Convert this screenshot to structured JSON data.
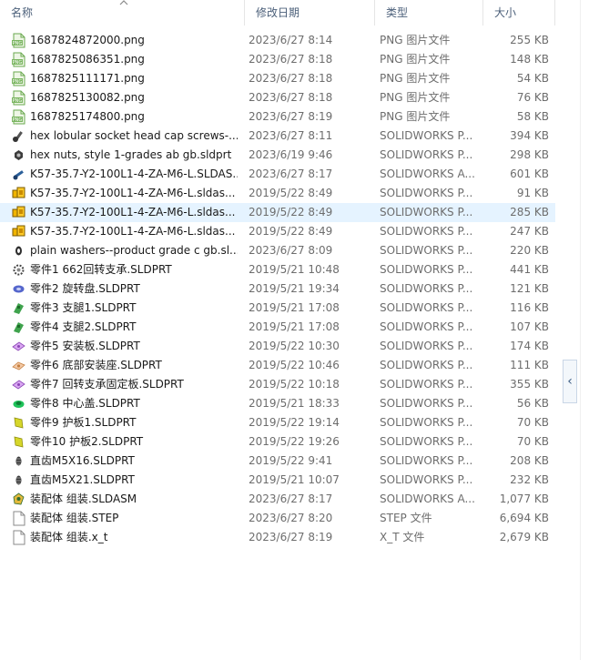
{
  "columns": {
    "name": "名称",
    "date": "修改日期",
    "type": "类型",
    "size": "大小"
  },
  "side_button_glyph": "‹",
  "files": [
    {
      "icon": "png-image-icon",
      "name": "1687824872000.png",
      "date": "2023/6/27 8:14",
      "type": "PNG 图片文件",
      "size": "255 KB"
    },
    {
      "icon": "png-image-icon",
      "name": "1687825086351.png",
      "date": "2023/6/27 8:18",
      "type": "PNG 图片文件",
      "size": "148 KB"
    },
    {
      "icon": "png-image-icon",
      "name": "1687825111171.png",
      "date": "2023/6/27 8:18",
      "type": "PNG 图片文件",
      "size": "54 KB"
    },
    {
      "icon": "png-image-icon",
      "name": "1687825130082.png",
      "date": "2023/6/27 8:18",
      "type": "PNG 图片文件",
      "size": "76 KB"
    },
    {
      "icon": "png-image-icon",
      "name": "1687825174800.png",
      "date": "2023/6/27 8:19",
      "type": "PNG 图片文件",
      "size": "58 KB"
    },
    {
      "icon": "screw-part-icon",
      "name": "hex lobular socket head cap screws-...",
      "date": "2023/6/27 8:11",
      "type": "SOLIDWORKS P...",
      "size": "394 KB"
    },
    {
      "icon": "nut-part-icon",
      "name": "hex nuts, style 1-grades ab gb.sldprt",
      "date": "2023/6/19 9:46",
      "type": "SOLIDWORKS P...",
      "size": "298 KB"
    },
    {
      "icon": "assembly-part-icon",
      "name": "K57-35.7-Y2-100L1-4-ZA-M6-L.SLDAS...",
      "date": "2023/6/27 8:17",
      "type": "SOLIDWORKS A...",
      "size": "601 KB"
    },
    {
      "icon": "yellow-part-icon",
      "name": "K57-35.7-Y2-100L1-4-ZA-M6-L.sldas...",
      "date": "2019/5/22 8:49",
      "type": "SOLIDWORKS P...",
      "size": "91 KB"
    },
    {
      "icon": "yellow-part-icon",
      "name": "K57-35.7-Y2-100L1-4-ZA-M6-L.sldas...",
      "date": "2019/5/22 8:49",
      "type": "SOLIDWORKS P...",
      "size": "285 KB",
      "selected": true
    },
    {
      "icon": "yellow-part-icon",
      "name": "K57-35.7-Y2-100L1-4-ZA-M6-L.sldas...",
      "date": "2019/5/22 8:49",
      "type": "SOLIDWORKS P...",
      "size": "247 KB"
    },
    {
      "icon": "washer-part-icon",
      "name": "plain washers--product grade c gb.sl...",
      "date": "2023/6/27 8:09",
      "type": "SOLIDWORKS P...",
      "size": "220 KB"
    },
    {
      "icon": "gear-part-icon",
      "name": "零件1 662回转支承.SLDPRT",
      "date": "2019/5/21 10:48",
      "type": "SOLIDWORKS P...",
      "size": "441 KB"
    },
    {
      "icon": "disc-part-icon",
      "name": "零件2 旋转盘.SLDPRT",
      "date": "2019/5/21 19:34",
      "type": "SOLIDWORKS P...",
      "size": "121 KB"
    },
    {
      "icon": "leg-part-icon",
      "name": "零件3  支腿1.SLDPRT",
      "date": "2019/5/21 17:08",
      "type": "SOLIDWORKS P...",
      "size": "116 KB"
    },
    {
      "icon": "leg-part-icon",
      "name": "零件4  支腿2.SLDPRT",
      "date": "2019/5/21 17:08",
      "type": "SOLIDWORKS P...",
      "size": "107 KB"
    },
    {
      "icon": "plate-part-icon",
      "name": "零件5 安装板.SLDPRT",
      "date": "2019/5/22 10:30",
      "type": "SOLIDWORKS P...",
      "size": "174 KB"
    },
    {
      "icon": "base-part-icon",
      "name": "零件6 底部安装座.SLDPRT",
      "date": "2019/5/22 10:46",
      "type": "SOLIDWORKS P...",
      "size": "111 KB"
    },
    {
      "icon": "plate-part-icon",
      "name": "零件7 回转支承固定板.SLDPRT",
      "date": "2019/5/22 10:18",
      "type": "SOLIDWORKS P...",
      "size": "355 KB"
    },
    {
      "icon": "cover-part-icon",
      "name": "零件8 中心盖.SLDPRT",
      "date": "2019/5/21 18:33",
      "type": "SOLIDWORKS P...",
      "size": "56 KB"
    },
    {
      "icon": "guard-part-icon",
      "name": "零件9 护板1.SLDPRT",
      "date": "2019/5/22 19:14",
      "type": "SOLIDWORKS P...",
      "size": "70 KB"
    },
    {
      "icon": "guard-part-icon",
      "name": "零件10 护板2.SLDPRT",
      "date": "2019/5/22 19:26",
      "type": "SOLIDWORKS P...",
      "size": "70 KB"
    },
    {
      "icon": "bolt-part-icon",
      "name": "直齿M5X16.SLDPRT",
      "date": "2019/5/22 9:41",
      "type": "SOLIDWORKS P...",
      "size": "208 KB"
    },
    {
      "icon": "bolt-part-icon",
      "name": "直齿M5X21.SLDPRT",
      "date": "2019/5/21 10:07",
      "type": "SOLIDWORKS P...",
      "size": "232 KB"
    },
    {
      "icon": "assembly-main-icon",
      "name": "装配体 组装.SLDASM",
      "date": "2023/6/27 8:17",
      "type": "SOLIDWORKS A...",
      "size": "1,077 KB"
    },
    {
      "icon": "blank-file-icon",
      "name": "装配体 组装.STEP",
      "date": "2023/6/27 8:20",
      "type": "STEP 文件",
      "size": "6,694 KB"
    },
    {
      "icon": "blank-file-icon",
      "name": "装配体 组装.x_t",
      "date": "2023/6/27 8:19",
      "type": "X_T 文件",
      "size": "2,679 KB"
    }
  ]
}
